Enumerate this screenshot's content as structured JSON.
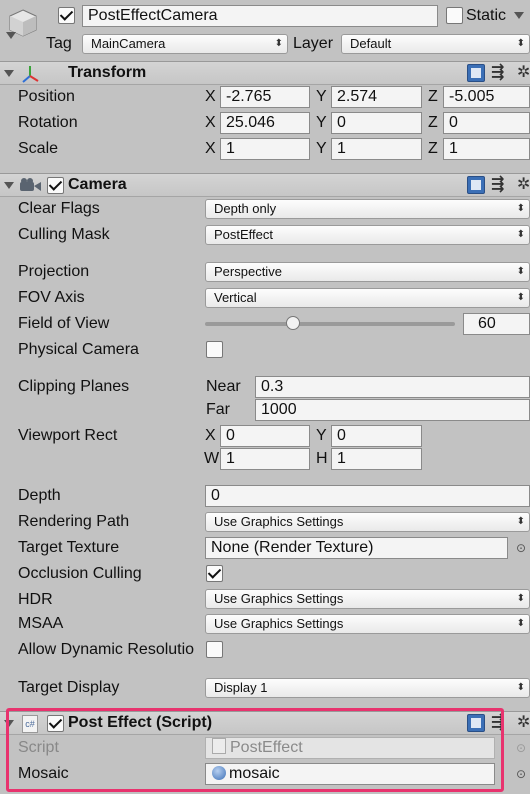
{
  "gameobject": {
    "name": "PostEffectCamera",
    "static_label": "Static",
    "tag_label": "Tag",
    "tag_value": "MainCamera",
    "layer_label": "Layer",
    "layer_value": "Default"
  },
  "transform": {
    "title": "Transform",
    "position": {
      "label": "Position",
      "x": "-2.765",
      "y": "2.574",
      "z": "-5.005"
    },
    "rotation": {
      "label": "Rotation",
      "x": "25.046",
      "y": "0",
      "z": "0"
    },
    "scale": {
      "label": "Scale",
      "x": "1",
      "y": "1",
      "z": "1"
    },
    "axis": {
      "x": "X",
      "y": "Y",
      "z": "Z"
    }
  },
  "camera": {
    "title": "Camera",
    "clear_flags": {
      "label": "Clear Flags",
      "value": "Depth only"
    },
    "culling_mask": {
      "label": "Culling Mask",
      "value": "PostEffect"
    },
    "projection": {
      "label": "Projection",
      "value": "Perspective"
    },
    "fov_axis": {
      "label": "FOV Axis",
      "value": "Vertical"
    },
    "field_of_view": {
      "label": "Field of View",
      "value": "60",
      "slider_fraction": 0.35
    },
    "physical_camera": {
      "label": "Physical Camera"
    },
    "clipping": {
      "label": "Clipping Planes",
      "near_label": "Near",
      "near": "0.3",
      "far_label": "Far",
      "far": "1000"
    },
    "viewport": {
      "label": "Viewport Rect",
      "x_label": "X",
      "x": "0",
      "y_label": "Y",
      "y": "0",
      "w_label": "W",
      "w": "1",
      "h_label": "H",
      "h": "1"
    },
    "depth": {
      "label": "Depth",
      "value": "0"
    },
    "rendering_path": {
      "label": "Rendering Path",
      "value": "Use Graphics Settings"
    },
    "target_texture": {
      "label": "Target Texture",
      "value": "None (Render Texture)"
    },
    "occlusion": {
      "label": "Occlusion Culling"
    },
    "hdr": {
      "label": "HDR",
      "value": "Use Graphics Settings"
    },
    "msaa": {
      "label": "MSAA",
      "value": "Use Graphics Settings"
    },
    "dynamic_res": {
      "label": "Allow Dynamic Resolutio"
    },
    "target_display": {
      "label": "Target Display",
      "value": "Display 1"
    }
  },
  "post_effect": {
    "title": "Post Effect (Script)",
    "script": {
      "label": "Script",
      "value": "PostEffect"
    },
    "mosaic": {
      "label": "Mosaic",
      "value": "mosaic"
    }
  },
  "colors": {
    "panel": "#c2c2c2",
    "highlight": "#e8336e",
    "check_blue": "#3b6fb6"
  }
}
